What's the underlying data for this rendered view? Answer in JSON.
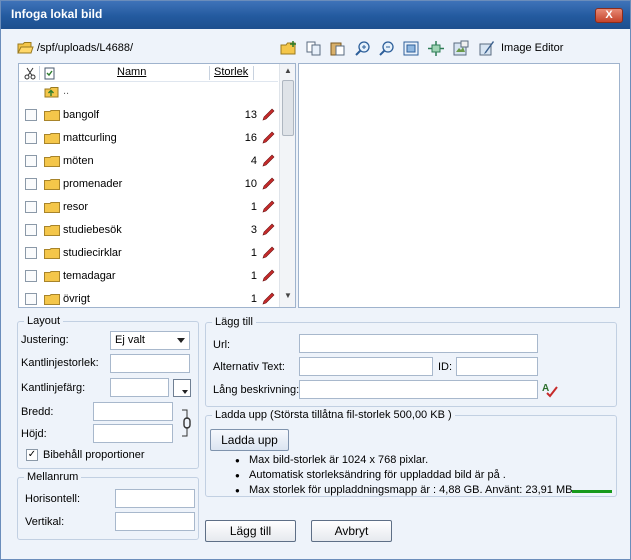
{
  "window": {
    "title": "Infoga lokal bild",
    "close_label": "X"
  },
  "path": "/spf/uploads/L4688/",
  "toolbar": {
    "image_editor_label": "Image Editor"
  },
  "file_list": {
    "headers": {
      "name": "Namn",
      "size": "Storlek"
    },
    "parent_label": "..",
    "items": [
      {
        "name": "bangolf",
        "size": "13"
      },
      {
        "name": "mattcurling",
        "size": "16"
      },
      {
        "name": "möten",
        "size": "4"
      },
      {
        "name": "promenader",
        "size": "10"
      },
      {
        "name": "resor",
        "size": "1"
      },
      {
        "name": "studiebesök",
        "size": "3"
      },
      {
        "name": "studiecirklar",
        "size": "1"
      },
      {
        "name": "temadagar",
        "size": "1"
      },
      {
        "name": "övrigt",
        "size": "1"
      }
    ]
  },
  "layout": {
    "legend": "Layout",
    "alignment_label": "Justering:",
    "alignment_value": "Ej valt",
    "border_size_label": "Kantlinjestorlek:",
    "border_color_label": "Kantlinjefärg:",
    "width_label": "Bredd:",
    "height_label": "Höjd:",
    "keep_proportions_label": "Bibehåll proportioner",
    "keep_proportions_checked": true
  },
  "spacing": {
    "legend": "Mellanrum",
    "horizontal_label": "Horisontell:",
    "vertical_label": "Vertikal:"
  },
  "add": {
    "legend": "Lägg till",
    "url_label": "Url:",
    "alt_text_label": "Alternativ Text:",
    "id_label": "ID:",
    "long_desc_label": "Lång beskrivning:"
  },
  "upload": {
    "legend": "Ladda upp (Största tillåtna fil-storlek 500,00 KB )",
    "button_label": "Ladda upp",
    "info": [
      "Max bild-storlek är 1024 x 768 pixlar.",
      "Automatisk storleksändring för uppladdad bild är på .",
      "Max storlek för uppladdningsmapp är : 4,88 GB. Använt: 23,91 MB"
    ],
    "quota_used_fraction": 0.005
  },
  "footer": {
    "add_label": "Lägg till",
    "cancel_label": "Avbryt"
  },
  "colors": {
    "title_bar": "#235a9f",
    "close": "#c4432b",
    "folder": "#f4c64a",
    "pencil": "#c62b2b",
    "quota_bar": "#179a1b"
  }
}
